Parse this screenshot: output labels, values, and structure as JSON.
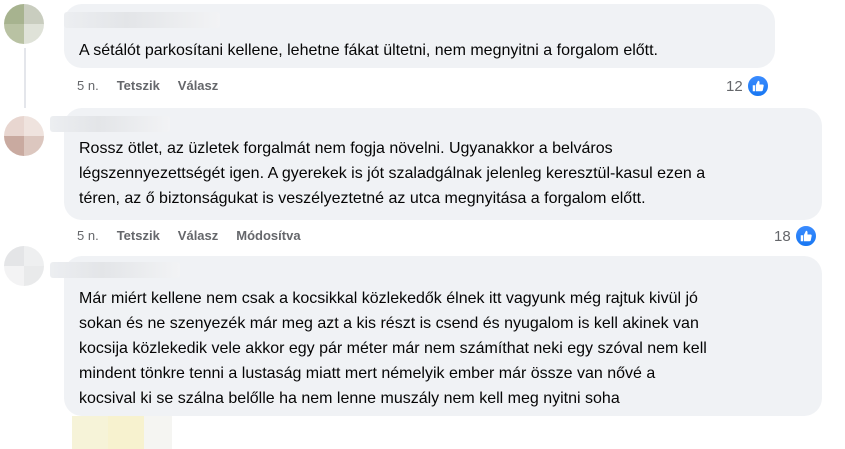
{
  "comments": [
    {
      "text_lines": [
        "A sétálót parkosítani kellene, lehetne fákat ültetni, nem megnyitni a forgalom előtt."
      ],
      "time": "5 n.",
      "like_label": "Tetszik",
      "reply_label": "Válasz",
      "reaction_count": "12",
      "reaction_icon": "thumbs-up-icon"
    },
    {
      "text_lines": [
        "Rossz ötlet, az üzletek forgalmát nem fogja növelni. Ugyanakkor a belváros",
        "légszennyezettségét igen. A gyerekek is jót szaladgálnak jelenleg keresztül-kasul ezen a",
        "téren, az ő biztonságukat is veszélyeztetné az utca megnyitása a forgalom előtt."
      ],
      "time": "5 n.",
      "like_label": "Tetszik",
      "reply_label": "Válasz",
      "edited_label": "Módosítva",
      "reaction_count": "18",
      "reaction_icon": "thumbs-up-icon"
    },
    {
      "text_lines": [
        "Már miért kellene nem csak a kocsikkal közlekedők élnek itt vagyunk még rajtuk kivül jó",
        "sokan és ne szenyezék már meg azt a kis részt is csend és nyugalom is kell akinek van",
        "kocsija közlekedik vele akkor egy pár méter már nem számíthat neki egy szóval nem kell",
        "mindent tönkre tenni a lustaság miatt mert némelyik ember már össze van nővé a",
        "kocsival ki se szálna belőlle ha nem lenne muszály nem kell meg nyitni soha"
      ]
    }
  ],
  "colors": {
    "bubble": "#f0f2f5",
    "meta_text": "#65676b",
    "like_blue": "#1877f2"
  }
}
